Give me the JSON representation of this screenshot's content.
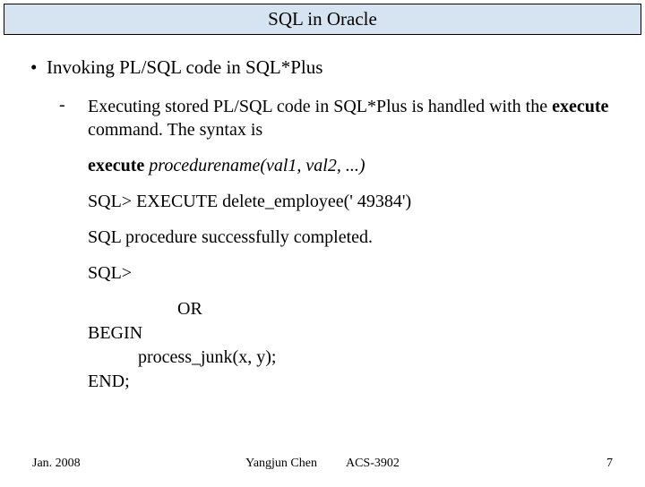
{
  "title": "SQL in Oracle",
  "bullet": {
    "marker": "•",
    "text": "Invoking PL/SQL code in SQL*Plus"
  },
  "sub": {
    "marker": "-",
    "text_pre": "Executing stored PL/SQL code in SQL*Plus is handled with the ",
    "text_bold": "execute",
    "text_post": " command. The syntax is"
  },
  "syntax": {
    "cmd": "execute",
    "args": " procedurename(val1, val2, ...)"
  },
  "example": "SQL> EXECUTE delete_employee(' 49384')",
  "result": "SQL procedure successfully completed.",
  "prompt": "SQL>",
  "alt": {
    "or": "OR",
    "begin": "BEGIN",
    "call": "process_junk(x, y);",
    "end": "END;"
  },
  "footer": {
    "date": "Jan. 2008",
    "author": "Yangjun Chen",
    "course": "ACS-3902",
    "page": "7"
  }
}
